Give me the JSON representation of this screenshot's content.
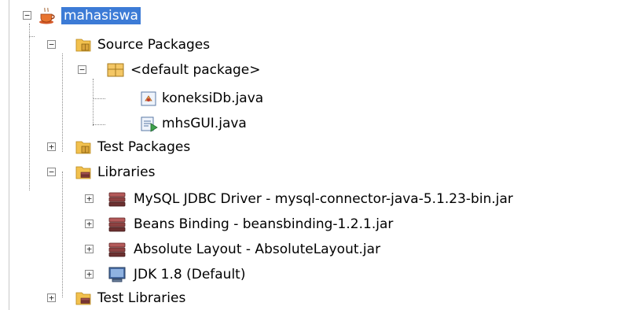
{
  "tree": {
    "project": {
      "label": "mahasiswa",
      "icon": "coffee-cup-project-icon",
      "expanded": true
    },
    "source_packages": {
      "label": "Source Packages",
      "icon": "package-folder-icon",
      "expanded": true
    },
    "default_package": {
      "label": "<default package>",
      "icon": "package-icon",
      "expanded": true
    },
    "files": [
      {
        "label": "koneksiDb.java",
        "icon": "java-class-icon"
      },
      {
        "label": "mhsGUI.java",
        "icon": "java-form-icon"
      }
    ],
    "test_packages": {
      "label": "Test Packages",
      "icon": "package-folder-icon",
      "expanded": false
    },
    "libraries": {
      "label": "Libraries",
      "icon": "library-folder-icon",
      "expanded": true
    },
    "library_items": [
      {
        "label": "MySQL JDBC Driver - mysql-connector-java-5.1.23-bin.jar",
        "icon": "jar-library-icon"
      },
      {
        "label": "Beans Binding - beansbinding-1.2.1.jar",
        "icon": "jar-library-icon"
      },
      {
        "label": "Absolute Layout - AbsoluteLayout.jar",
        "icon": "jar-library-icon"
      },
      {
        "label": "JDK 1.8 (Default)",
        "icon": "jdk-monitor-icon"
      }
    ],
    "test_libraries": {
      "label": "Test Libraries",
      "icon": "library-folder-icon",
      "expanded": false
    },
    "toggle_symbols": {
      "expanded": "−",
      "collapsed": "+"
    }
  }
}
